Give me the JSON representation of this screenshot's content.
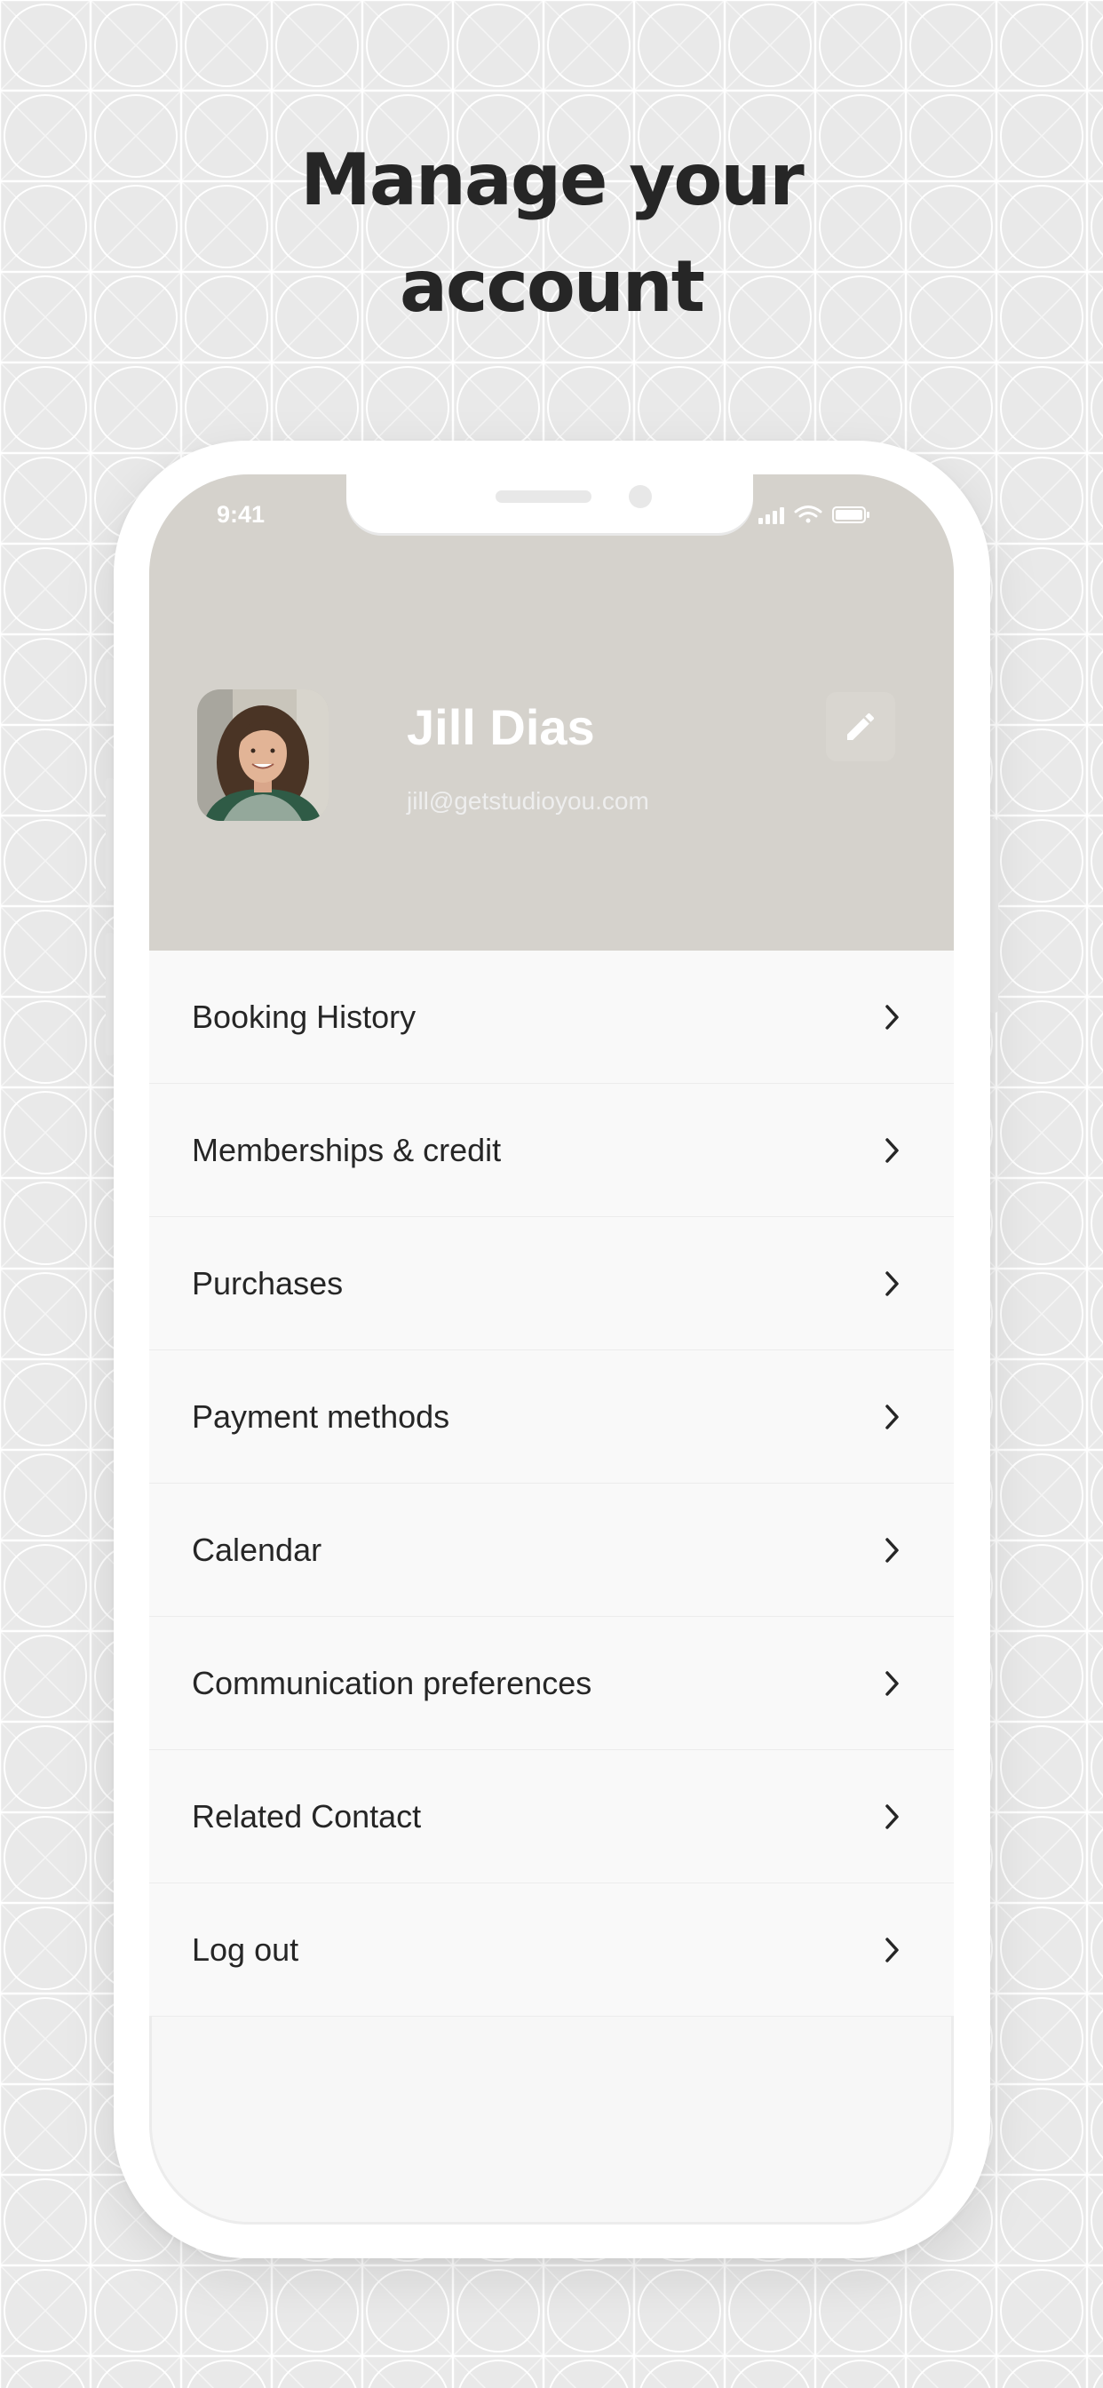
{
  "headline": {
    "line1": "Manage your",
    "line2": "account"
  },
  "status_bar": {
    "time": "9:41"
  },
  "profile": {
    "name": "Jill Dias",
    "email": "jill@getstudioyou.com",
    "avatar": "portrait-photo",
    "edit_icon": "pencil-icon"
  },
  "menu": {
    "items": [
      {
        "label": "Booking History"
      },
      {
        "label": "Memberships & credit"
      },
      {
        "label": "Purchases"
      },
      {
        "label": "Payment methods"
      },
      {
        "label": "Calendar"
      },
      {
        "label": "Communication preferences"
      },
      {
        "label": "Related Contact"
      },
      {
        "label": "Log out"
      }
    ],
    "chevron_icon": "chevron-right-icon"
  },
  "colors": {
    "page_background": "#e9e9e9",
    "header_background": "#d5d2cc",
    "text_dark": "#262626",
    "phone_frame": "#ffffff"
  }
}
